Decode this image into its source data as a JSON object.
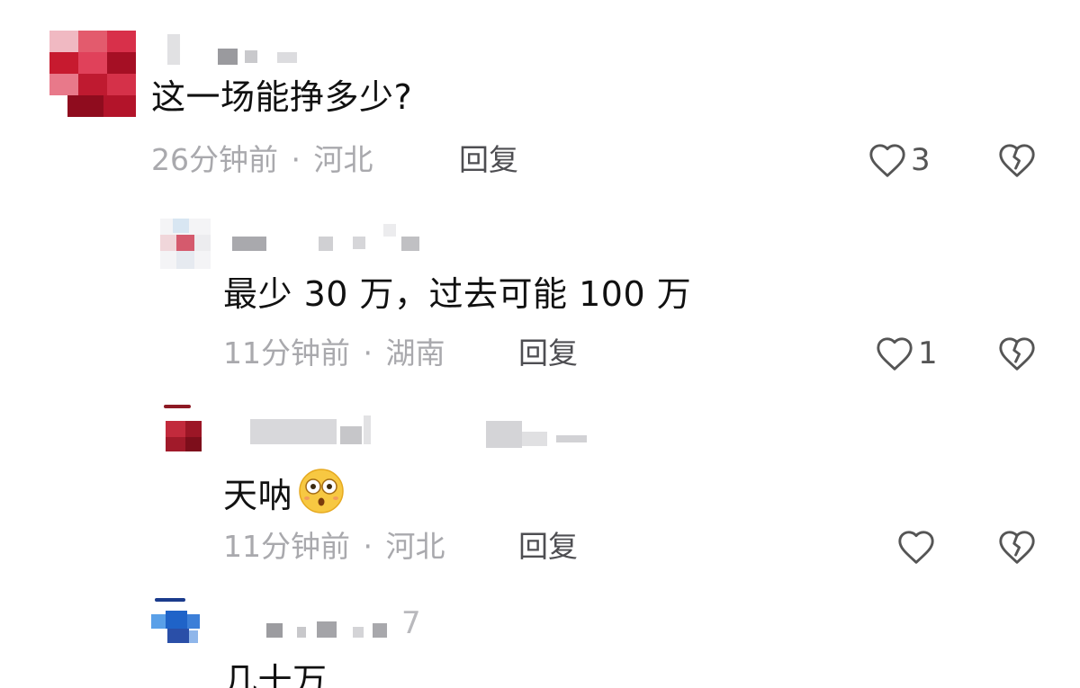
{
  "comments": [
    {
      "text": "这一场能挣多少?",
      "time": "26分钟前",
      "sep": "·",
      "location": "河北",
      "reply_label": "回复",
      "likes": "3"
    },
    {
      "text": "最少 30 万，过去可能 100 万",
      "time": "11分钟前",
      "sep": "·",
      "location": "湖南",
      "reply_label": "回复",
      "likes": "1"
    },
    {
      "text": "天呐",
      "emoji": "astonished-face-emoji",
      "time": "11分钟前",
      "sep": "·",
      "location": "河北",
      "reply_label": "回复",
      "likes": ""
    },
    {
      "text": "几十万",
      "name_suffix": "7"
    }
  ],
  "icons": {
    "like": "heart-outline-icon",
    "dislike": "broken-heart-icon"
  },
  "colors": {
    "text": "#111111",
    "meta": "#a9a9ad",
    "reply": "#4e4e52",
    "icon": "#555555"
  }
}
